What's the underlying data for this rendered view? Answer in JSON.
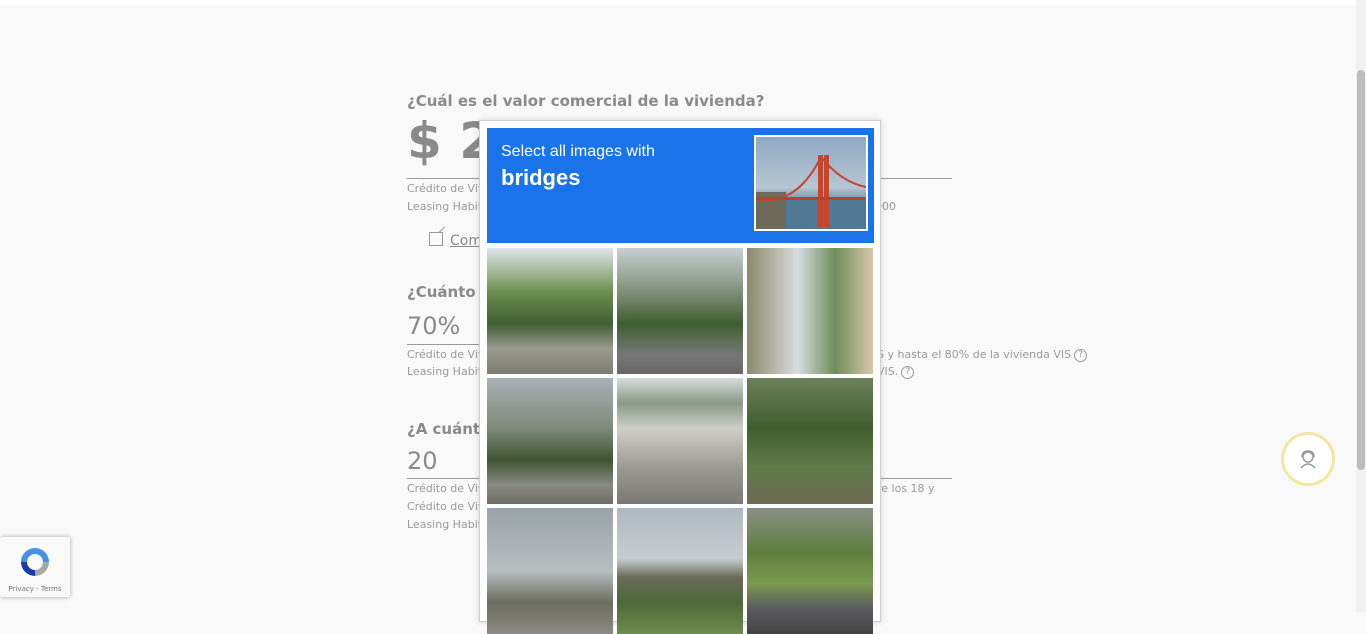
{
  "form": {
    "q1": "¿Cuál es el valor comercial de la vivienda?",
    "value1": "$ 2",
    "note1a": "Crédito de Viv",
    "note1b": "Leasing Habit",
    "note1c": "000",
    "link": "Com",
    "q2": "¿Cuánto c",
    "value2": "70%",
    "note2a": "Crédito de Viv",
    "note2a_right": "S y hasta el 80% de la vivienda VIS",
    "note2b": "Leasing Habit",
    "note2b_right": "VIS.",
    "help": "?",
    "q3": "¿A cuánto",
    "value3": "20",
    "note3a": "Crédito de Viv",
    "note3a_right": "re los 18 y",
    "note3b": "Crédito de Viv",
    "note3c": "Leasing Habit"
  },
  "challenge": {
    "prompt_line1": "Select all images with",
    "prompt_target": "bridges",
    "tile_count": 9
  },
  "recaptcha": {
    "legal": "Privacy - Terms"
  },
  "colors": {
    "header_blue": "#1a73e8",
    "support_ring": "#f2e6a0"
  }
}
